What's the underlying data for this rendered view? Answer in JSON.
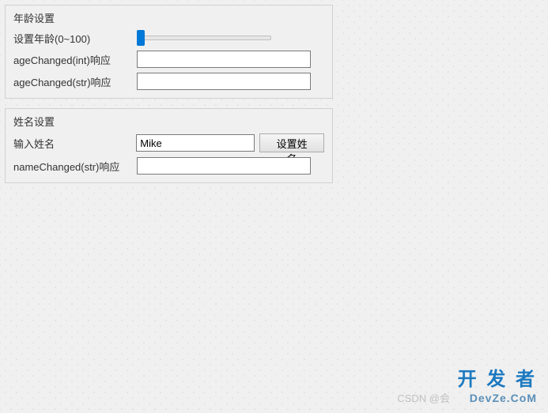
{
  "age_group": {
    "title": "年龄设置",
    "slider_label": "设置年龄(0~100)",
    "int_response_label": "ageChanged(int)响应",
    "int_response_value": "",
    "str_response_label": "ageChanged(str)响应",
    "str_response_value": ""
  },
  "name_group": {
    "title": "姓名设置",
    "input_label": "输入姓名",
    "input_value": "Mike",
    "button_label": "设置姓名",
    "response_label": "nameChanged(str)响应",
    "response_value": ""
  },
  "watermark": {
    "csdn": "CSDN @会",
    "title": "开 发 者",
    "sub": "DevZe.CoM"
  }
}
